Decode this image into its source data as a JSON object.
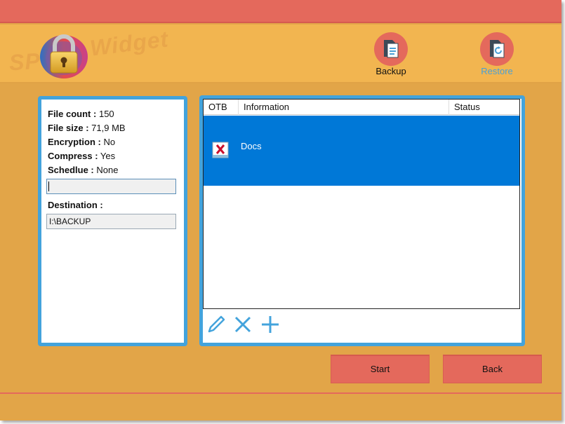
{
  "header": {
    "logo_part1": "SP",
    "logo_part2": "Widget",
    "nav": [
      {
        "label": "Backup",
        "active": true
      },
      {
        "label": "Restore",
        "active": false
      }
    ]
  },
  "summary": {
    "file_count_label": "File count :",
    "file_count_value": "150",
    "file_size_label": "File size :",
    "file_size_value": "71,9 MB",
    "encryption_label": "Encryption :",
    "encryption_value": "No",
    "compress_label": "Compress :",
    "compress_value": "Yes",
    "schedule_label": "Schedlue :",
    "schedule_value": "None",
    "name_input_value": "",
    "destination_label": "Destination :",
    "destination_value": "I:\\BACKUP"
  },
  "table": {
    "columns": [
      "OTB",
      "Information",
      "Status"
    ],
    "rows": [
      {
        "otb_icon": "x-mark-icon",
        "information": "Docs",
        "status": "",
        "selected": true
      }
    ]
  },
  "toolbar": {
    "icons": [
      "pencil-icon",
      "delete-x-icon",
      "plus-icon"
    ]
  },
  "buttons": {
    "start_label": "Start",
    "back_label": "Back"
  },
  "colors": {
    "title_bar": "#e4695c",
    "header": "#f2b550",
    "body": "#e2a548",
    "panel_border": "#43a3dc",
    "selection": "#0078d7",
    "restore_text": "#4aa0d5"
  }
}
